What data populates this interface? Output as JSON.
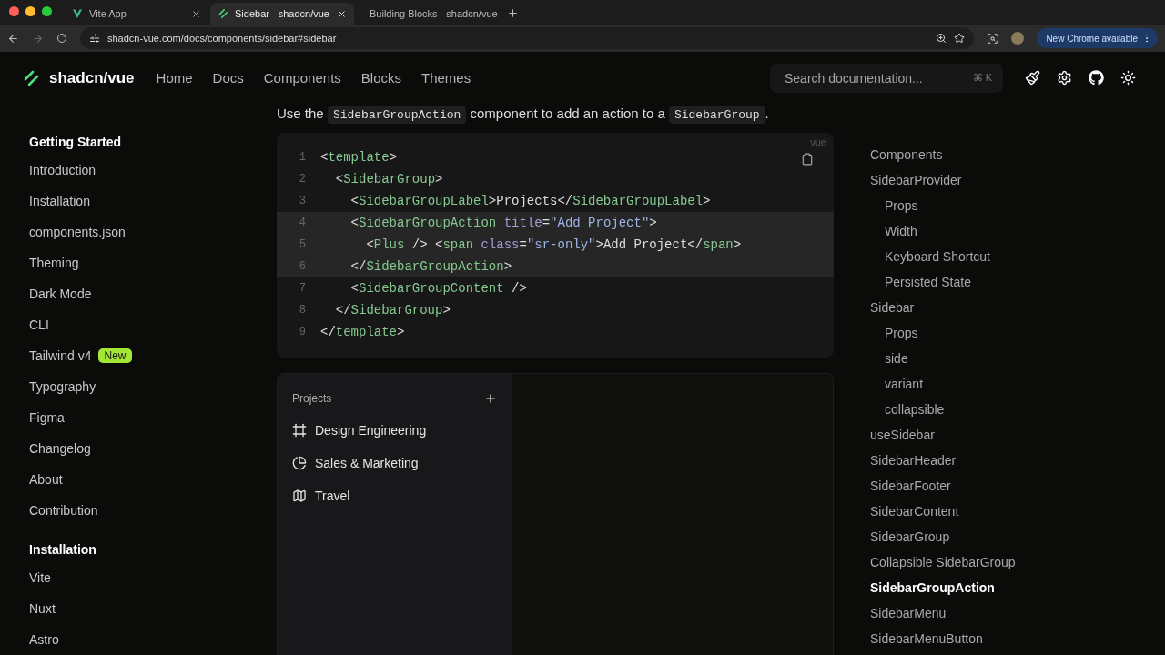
{
  "browser": {
    "tabs": [
      {
        "title": "Vite App",
        "selected": false
      },
      {
        "title": "Sidebar - shadcn/vue",
        "selected": true
      },
      {
        "title": "Building Blocks - shadcn/vue",
        "selected": false
      }
    ],
    "url": "shadcn-vue.com/docs/components/sidebar#sidebar",
    "update_button": "New Chrome available"
  },
  "header": {
    "logo": "shadcn/vue",
    "nav": [
      "Home",
      "Docs",
      "Components",
      "Blocks",
      "Themes"
    ],
    "search": {
      "placeholder": "Search documentation...",
      "shortcut": "⌘ K"
    }
  },
  "sidebar": {
    "sections": [
      {
        "title": "Getting Started",
        "items": [
          {
            "label": "Introduction"
          },
          {
            "label": "Installation"
          },
          {
            "label": "components.json"
          },
          {
            "label": "Theming"
          },
          {
            "label": "Dark Mode"
          },
          {
            "label": "CLI"
          },
          {
            "label": "Tailwind v4",
            "badge": "New"
          },
          {
            "label": "Typography"
          },
          {
            "label": "Figma"
          },
          {
            "label": "Changelog"
          },
          {
            "label": "About"
          },
          {
            "label": "Contribution"
          }
        ]
      },
      {
        "title": "Installation",
        "items": [
          {
            "label": "Vite"
          },
          {
            "label": "Nuxt"
          },
          {
            "label": "Astro"
          }
        ]
      }
    ]
  },
  "content": {
    "intro": [
      {
        "kind": "text",
        "text": "Use the "
      },
      {
        "kind": "code",
        "text": "SidebarGroupAction"
      },
      {
        "kind": "text",
        "text": " component to add an action to a "
      },
      {
        "kind": "code",
        "text": "SidebarGroup"
      },
      {
        "kind": "text",
        "text": "."
      }
    ],
    "code_block": {
      "language": "vue",
      "lines": [
        {
          "number": "1",
          "highlighted": false,
          "tokens": [
            {
              "kind": "punct",
              "text": "<"
            },
            {
              "kind": "tag",
              "text": "template"
            },
            {
              "kind": "punct",
              "text": ">"
            }
          ]
        },
        {
          "number": "2",
          "highlighted": false,
          "tokens": [
            {
              "kind": "punct",
              "text": "  <"
            },
            {
              "kind": "tag",
              "text": "SidebarGroup"
            },
            {
              "kind": "punct",
              "text": ">"
            }
          ]
        },
        {
          "number": "3",
          "highlighted": false,
          "tokens": [
            {
              "kind": "punct",
              "text": "    <"
            },
            {
              "kind": "tag",
              "text": "SidebarGroupLabel"
            },
            {
              "kind": "punct",
              "text": ">Projects</"
            },
            {
              "kind": "tag",
              "text": "SidebarGroupLabel"
            },
            {
              "kind": "punct",
              "text": ">"
            }
          ]
        },
        {
          "number": "4",
          "highlighted": true,
          "tokens": [
            {
              "kind": "punct",
              "text": "    <"
            },
            {
              "kind": "tag",
              "text": "SidebarGroupAction"
            },
            {
              "kind": "attr",
              "text": " title"
            },
            {
              "kind": "punct",
              "text": "="
            },
            {
              "kind": "string",
              "text": "\"Add Project\""
            },
            {
              "kind": "punct",
              "text": ">"
            }
          ]
        },
        {
          "number": "5",
          "highlighted": true,
          "tokens": [
            {
              "kind": "punct",
              "text": "      <"
            },
            {
              "kind": "tag",
              "text": "Plus"
            },
            {
              "kind": "punct",
              "text": " /> <"
            },
            {
              "kind": "tag",
              "text": "span"
            },
            {
              "kind": "attr",
              "text": " class"
            },
            {
              "kind": "punct",
              "text": "="
            },
            {
              "kind": "string",
              "text": "\"sr-only\""
            },
            {
              "kind": "punct",
              "text": ">Add Project</"
            },
            {
              "kind": "tag",
              "text": "span"
            },
            {
              "kind": "punct",
              "text": ">"
            }
          ]
        },
        {
          "number": "6",
          "highlighted": true,
          "tokens": [
            {
              "kind": "punct",
              "text": "    </"
            },
            {
              "kind": "tag",
              "text": "SidebarGroupAction"
            },
            {
              "kind": "punct",
              "text": ">"
            }
          ]
        },
        {
          "number": "7",
          "highlighted": false,
          "tokens": [
            {
              "kind": "punct",
              "text": "    <"
            },
            {
              "kind": "tag",
              "text": "SidebarGroupContent"
            },
            {
              "kind": "punct",
              "text": " />"
            }
          ]
        },
        {
          "number": "8",
          "highlighted": false,
          "tokens": [
            {
              "kind": "punct",
              "text": "  </"
            },
            {
              "kind": "tag",
              "text": "SidebarGroup"
            },
            {
              "kind": "punct",
              "text": ">"
            }
          ]
        },
        {
          "number": "9",
          "highlighted": false,
          "tokens": [
            {
              "kind": "punct",
              "text": "</"
            },
            {
              "kind": "tag",
              "text": "template"
            },
            {
              "kind": "punct",
              "text": ">"
            }
          ]
        }
      ]
    },
    "preview": {
      "group_label": "Projects",
      "items": [
        {
          "label": "Design Engineering"
        },
        {
          "label": "Sales & Marketing"
        },
        {
          "label": "Travel"
        }
      ]
    }
  },
  "toc": [
    {
      "label": "Components",
      "selected": false
    },
    {
      "label": "SidebarProvider",
      "selected": false,
      "children": [
        {
          "label": "Props",
          "selected": false
        },
        {
          "label": "Width",
          "selected": false
        },
        {
          "label": "Keyboard Shortcut",
          "selected": false
        },
        {
          "label": "Persisted State",
          "selected": false
        }
      ]
    },
    {
      "label": "Sidebar",
      "selected": false,
      "children": [
        {
          "label": "Props",
          "selected": false
        },
        {
          "label": "side",
          "selected": false
        },
        {
          "label": "variant",
          "selected": false
        },
        {
          "label": "collapsible",
          "selected": false
        }
      ]
    },
    {
      "label": "useSidebar",
      "selected": false
    },
    {
      "label": "SidebarHeader",
      "selected": false
    },
    {
      "label": "SidebarFooter",
      "selected": false
    },
    {
      "label": "SidebarContent",
      "selected": false
    },
    {
      "label": "SidebarGroup",
      "selected": false
    },
    {
      "label": "Collapsible SidebarGroup",
      "selected": false
    },
    {
      "label": "SidebarGroupAction",
      "selected": true
    },
    {
      "label": "SidebarMenu",
      "selected": false
    },
    {
      "label": "SidebarMenuButton",
      "selected": false
    }
  ]
}
